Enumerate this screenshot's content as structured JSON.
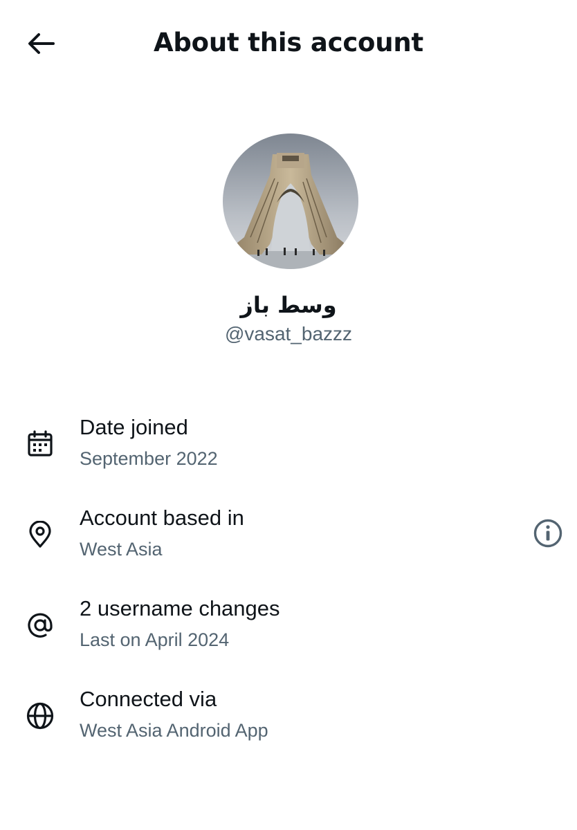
{
  "header": {
    "back_icon": "arrow-left-icon",
    "title": "About this account"
  },
  "profile": {
    "avatar_icon": "azadi-tower-avatar",
    "display_name": "وسط باز",
    "handle": "@vasat_bazzz"
  },
  "rows": [
    {
      "icon": "calendar-icon",
      "title": "Date joined",
      "subtitle": "September 2022"
    },
    {
      "icon": "location-pin-icon",
      "title": "Account based in",
      "subtitle": "West Asia",
      "action_icon": "info-icon"
    },
    {
      "icon": "at-sign-icon",
      "title": "2 username changes",
      "subtitle": "Last on April 2024"
    },
    {
      "icon": "globe-icon",
      "title": "Connected via",
      "subtitle": "West Asia Android App"
    }
  ],
  "colors": {
    "text_primary": "#0f1419",
    "text_secondary": "#536471",
    "background": "#ffffff"
  }
}
